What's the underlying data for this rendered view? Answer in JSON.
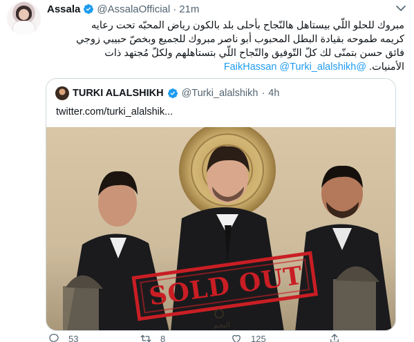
{
  "tweet": {
    "author_name": "Assala",
    "author_handle": "@AssalaOfficial",
    "separator": "·",
    "time": "21m",
    "text_lines": [
      "مبروك للحلو اللّي بيستاهل هالنّجاح بأحلى بلد بالكون رياض المحبّه تحت رعايه",
      "كريمه طموحه بقيادة البطل المحبوب أبو ناصر مبروك للجميع وبخصّ حبيبي زوجي",
      "فائق حسن بتمنّى لك كلّ التّوفيق والنّجاح اللّي بتستاهلهم  ولكلّ مُجتهد ذات",
      "الأمنيات."
    ],
    "mention_1": "@FaikHassan",
    "mention_2": "@Turki_alalshikh"
  },
  "quote": {
    "author_name": "TURKI ALALSHIKH",
    "author_handle": "@Turki_alalshikh",
    "separator": "·",
    "time": "4h",
    "link": "twitter.com/turki_alalshik...",
    "poster_text": "SOLD OUT",
    "poster_small_text": "النجم"
  },
  "actions": {
    "reply_count": "53",
    "retweet_count": "8",
    "like_count": "125"
  },
  "colors": {
    "link_blue": "#1d9bf0",
    "secondary_text": "#536471",
    "stamp_red": "#c91e24",
    "border": "#cfd9de"
  },
  "icons": [
    "verified-badge-icon",
    "more-caret-icon",
    "reply-icon",
    "retweet-icon",
    "like-icon",
    "share-icon"
  ]
}
